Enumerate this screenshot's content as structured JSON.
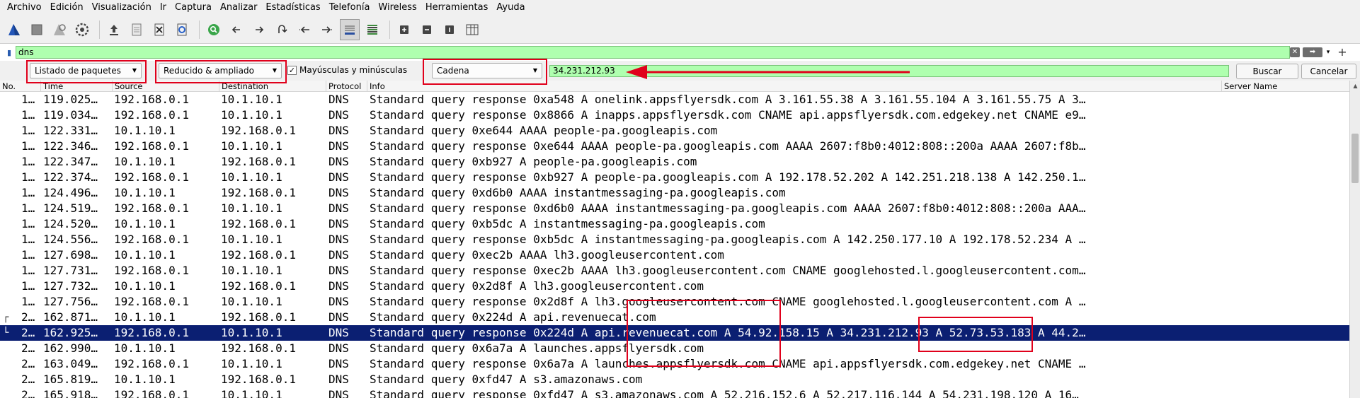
{
  "menu": [
    "Archivo",
    "Edición",
    "Visualización",
    "Ir",
    "Captura",
    "Analizar",
    "Estadísticas",
    "Telefonía",
    "Wireless",
    "Herramientas",
    "Ayuda"
  ],
  "toolbar_icons": [
    "shark-fin-start-icon",
    "stop-icon",
    "restart-icon",
    "options-gear-icon",
    "open-upload-icon",
    "file-icon",
    "close-file-icon",
    "reload-icon",
    "find-packet-icon",
    "back-arrow-icon",
    "forward-arrow-icon",
    "go-to-packet-icon",
    "first-packet-icon",
    "last-packet-icon",
    "autoscroll-icon",
    "colorize-icon",
    "zoom-in-icon",
    "zoom-out-icon",
    "normal-size-icon",
    "resize-columns-icon"
  ],
  "display_filter": {
    "value": "dns"
  },
  "find": {
    "search_in": "Listado de paquetes",
    "char_width": "Reducido & ampliado",
    "case_label": "Mayúsculas y minúsculas",
    "case_checked": true,
    "type": "Cadena",
    "value": "34.231.212.93",
    "search_label": "Buscar",
    "cancel_label": "Cancelar"
  },
  "columns": [
    "No.",
    "Time",
    "Source",
    "Destination",
    "Protocol",
    "Info",
    "Server Name"
  ],
  "rows": [
    {
      "no": "1…",
      "time": "119.025…",
      "src": "192.168.0.1",
      "dst": "10.1.10.1",
      "proto": "DNS",
      "info": "Standard query response 0xa548 A onelink.appsflyersdk.com A 3.161.55.38 A 3.161.55.104 A 3.161.55.75 A 3…",
      "selected": false,
      "mark": ""
    },
    {
      "no": "1…",
      "time": "119.034…",
      "src": "192.168.0.1",
      "dst": "10.1.10.1",
      "proto": "DNS",
      "info": "Standard query response 0x8866 A inapps.appsflyersdk.com CNAME api.appsflyersdk.com.edgekey.net CNAME e9…",
      "selected": false,
      "mark": ""
    },
    {
      "no": "1…",
      "time": "122.331…",
      "src": "10.1.10.1",
      "dst": "192.168.0.1",
      "proto": "DNS",
      "info": "Standard query 0xe644 AAAA people-pa.googleapis.com",
      "selected": false,
      "mark": ""
    },
    {
      "no": "1…",
      "time": "122.346…",
      "src": "192.168.0.1",
      "dst": "10.1.10.1",
      "proto": "DNS",
      "info": "Standard query response 0xe644 AAAA people-pa.googleapis.com AAAA 2607:f8b0:4012:808::200a AAAA 2607:f8b…",
      "selected": false,
      "mark": ""
    },
    {
      "no": "1…",
      "time": "122.347…",
      "src": "10.1.10.1",
      "dst": "192.168.0.1",
      "proto": "DNS",
      "info": "Standard query 0xb927 A people-pa.googleapis.com",
      "selected": false,
      "mark": ""
    },
    {
      "no": "1…",
      "time": "122.374…",
      "src": "192.168.0.1",
      "dst": "10.1.10.1",
      "proto": "DNS",
      "info": "Standard query response 0xb927 A people-pa.googleapis.com A 192.178.52.202 A 142.251.218.138 A 142.250.1…",
      "selected": false,
      "mark": ""
    },
    {
      "no": "1…",
      "time": "124.496…",
      "src": "10.1.10.1",
      "dst": "192.168.0.1",
      "proto": "DNS",
      "info": "Standard query 0xd6b0 AAAA instantmessaging-pa.googleapis.com",
      "selected": false,
      "mark": ""
    },
    {
      "no": "1…",
      "time": "124.519…",
      "src": "192.168.0.1",
      "dst": "10.1.10.1",
      "proto": "DNS",
      "info": "Standard query response 0xd6b0 AAAA instantmessaging-pa.googleapis.com AAAA 2607:f8b0:4012:808::200a AAA…",
      "selected": false,
      "mark": ""
    },
    {
      "no": "1…",
      "time": "124.520…",
      "src": "10.1.10.1",
      "dst": "192.168.0.1",
      "proto": "DNS",
      "info": "Standard query 0xb5dc A instantmessaging-pa.googleapis.com",
      "selected": false,
      "mark": ""
    },
    {
      "no": "1…",
      "time": "124.556…",
      "src": "192.168.0.1",
      "dst": "10.1.10.1",
      "proto": "DNS",
      "info": "Standard query response 0xb5dc A instantmessaging-pa.googleapis.com A 142.250.177.10 A 192.178.52.234 A …",
      "selected": false,
      "mark": ""
    },
    {
      "no": "1…",
      "time": "127.698…",
      "src": "10.1.10.1",
      "dst": "192.168.0.1",
      "proto": "DNS",
      "info": "Standard query 0xec2b AAAA lh3.googleusercontent.com",
      "selected": false,
      "mark": ""
    },
    {
      "no": "1…",
      "time": "127.731…",
      "src": "192.168.0.1",
      "dst": "10.1.10.1",
      "proto": "DNS",
      "info": "Standard query response 0xec2b AAAA lh3.googleusercontent.com CNAME googlehosted.l.googleusercontent.com…",
      "selected": false,
      "mark": ""
    },
    {
      "no": "1…",
      "time": "127.732…",
      "src": "10.1.10.1",
      "dst": "192.168.0.1",
      "proto": "DNS",
      "info": "Standard query 0x2d8f A lh3.googleusercontent.com",
      "selected": false,
      "mark": ""
    },
    {
      "no": "1…",
      "time": "127.756…",
      "src": "192.168.0.1",
      "dst": "10.1.10.1",
      "proto": "DNS",
      "info": "Standard query response 0x2d8f A lh3.googleusercontent.com CNAME googlehosted.l.googleusercontent.com A …",
      "selected": false,
      "mark": ""
    },
    {
      "no": "2…",
      "time": "162.871…",
      "src": "10.1.10.1",
      "dst": "192.168.0.1",
      "proto": "DNS",
      "info": "Standard query 0x224d A api.revenuecat.com",
      "selected": false,
      "mark": "┌"
    },
    {
      "no": "2…",
      "time": "162.925…",
      "src": "192.168.0.1",
      "dst": "10.1.10.1",
      "proto": "DNS",
      "info": "Standard query response 0x224d A api.revenuecat.com A 54.92.158.15 A 34.231.212.93 A 52.73.53.183 A 44.2…",
      "selected": true,
      "mark": "└"
    },
    {
      "no": "2…",
      "time": "162.990…",
      "src": "10.1.10.1",
      "dst": "192.168.0.1",
      "proto": "DNS",
      "info": "Standard query 0x6a7a A launches.appsflyersdk.com",
      "selected": false,
      "mark": ""
    },
    {
      "no": "2…",
      "time": "163.049…",
      "src": "192.168.0.1",
      "dst": "10.1.10.1",
      "proto": "DNS",
      "info": "Standard query response 0x6a7a A launches.appsflyersdk.com CNAME api.appsflyersdk.com.edgekey.net CNAME …",
      "selected": false,
      "mark": ""
    },
    {
      "no": "2…",
      "time": "165.819…",
      "src": "10.1.10.1",
      "dst": "192.168.0.1",
      "proto": "DNS",
      "info": "Standard query 0xfd47 A s3.amazonaws.com",
      "selected": false,
      "mark": ""
    },
    {
      "no": "2…",
      "time": "165.918…",
      "src": "192.168.0.1",
      "dst": "10.1.10.1",
      "proto": "DNS",
      "info": "Standard query response 0xfd47 A s3.amazonaws.com A 52.216.152.6 A 52.217.116.144 A 54.231.198.120 A 16…",
      "selected": false,
      "mark": ""
    }
  ],
  "colors": {
    "selected_row_bg": "#0b1f72",
    "filter_valid_bg": "#afffaf",
    "annotation_red": "#e0001b"
  }
}
